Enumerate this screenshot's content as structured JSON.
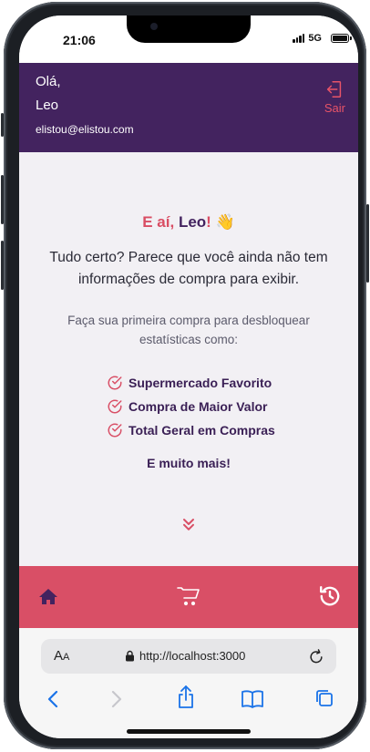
{
  "status": {
    "time": "21:06",
    "network": "5G"
  },
  "header": {
    "greeting": "Olá,",
    "name": "Leo",
    "email": "elistou@elistou.com",
    "logout_label": "Sair"
  },
  "main": {
    "hey_prefix": "E aí, ",
    "hey_name": "Leo",
    "hey_suffix": "! 👋",
    "lead": "Tudo certo? Parece que você ainda não tem informações de compra para exibir.",
    "sub": "Faça sua primeira compra para desbloquear estatísticas como:",
    "features": [
      "Supermercado Favorito",
      "Compra de Maior Valor",
      "Total Geral em Compras"
    ],
    "more": "E muito mais!"
  },
  "tabbar": {
    "items": [
      "home-icon",
      "cart-icon",
      "history-icon"
    ]
  },
  "browser": {
    "aa_big": "A",
    "aa_small": "A",
    "url": "http://localhost:3000"
  },
  "colors": {
    "header": "#43235f",
    "accent": "#d94f66",
    "background": "#f2f0f4"
  }
}
